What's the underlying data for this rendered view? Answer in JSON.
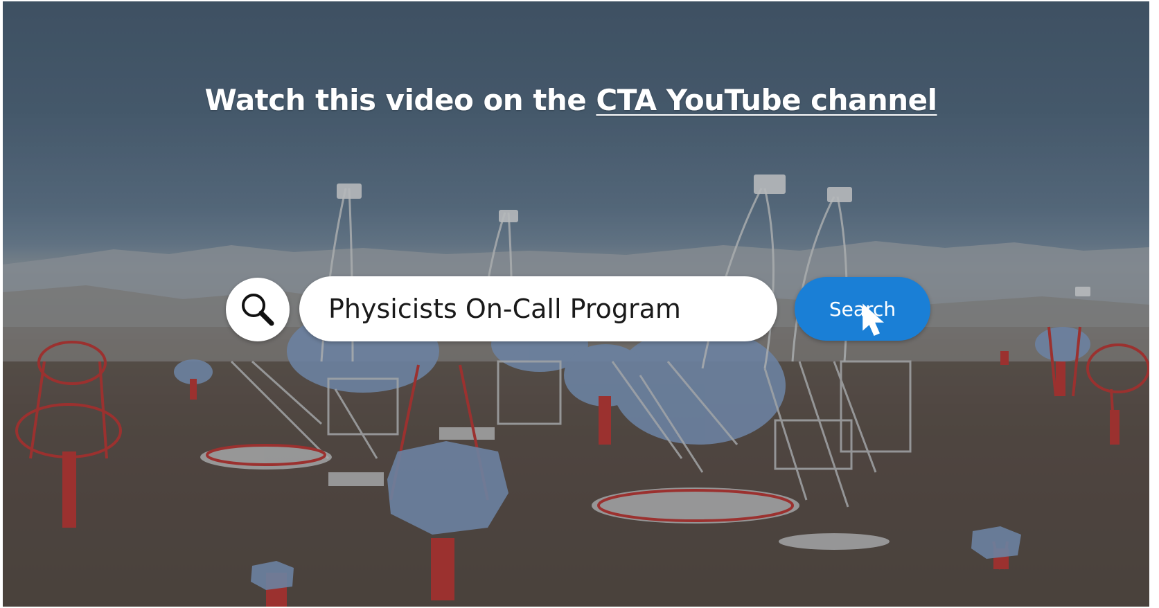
{
  "headline": {
    "prefix": "Watch this video on the ",
    "link_text": "CTA YouTube channel"
  },
  "search": {
    "icon": "magnifier-icon",
    "value": "Physicists On-Call Program",
    "button_label": "Search"
  },
  "cursor": {
    "icon": "mouse-pointer-icon"
  },
  "colors": {
    "button": "#1a7fd6",
    "sky": "#4e6276",
    "ground": "#5d4f46",
    "structure_red": "#b8322e"
  }
}
